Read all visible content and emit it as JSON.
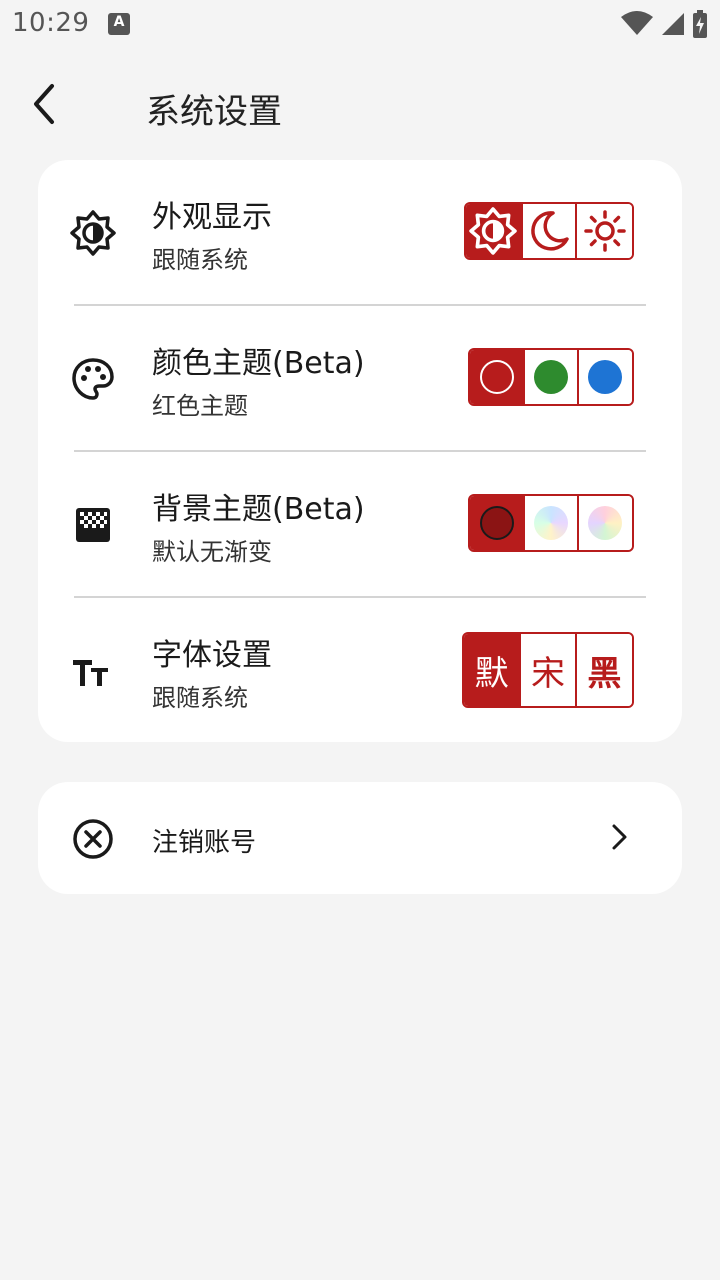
{
  "status": {
    "time": "10:29",
    "notification_letter": "A"
  },
  "header": {
    "title": "系统设置"
  },
  "settings": [
    {
      "title": "外观显示",
      "subtitle": "跟随系统",
      "icon": "brightness-auto-icon",
      "options": [
        "follow-system-icon",
        "dark-mode-icon",
        "light-mode-icon"
      ],
      "selected": 0
    },
    {
      "title": "颜色主题(Beta)",
      "subtitle": "红色主题",
      "icon": "palette-icon",
      "options": [
        "#b71c1c",
        "#2e8b2e",
        "#1e74d4"
      ],
      "selected": 0
    },
    {
      "title": "背景主题(Beta)",
      "subtitle": "默认无渐变",
      "icon": "gradient-icon",
      "options": [
        "#8b1414",
        "gradient-blue",
        "gradient-pink"
      ],
      "selected": 0
    },
    {
      "title": "字体设置",
      "subtitle": "跟随系统",
      "icon": "text-size-icon",
      "options": [
        "默",
        "宋",
        "黑"
      ],
      "selected": 0
    }
  ],
  "account": {
    "label": "注销账号"
  },
  "colors": {
    "accent": "#b71c1c",
    "background": "#f4f4f4",
    "card": "#ffffff"
  }
}
